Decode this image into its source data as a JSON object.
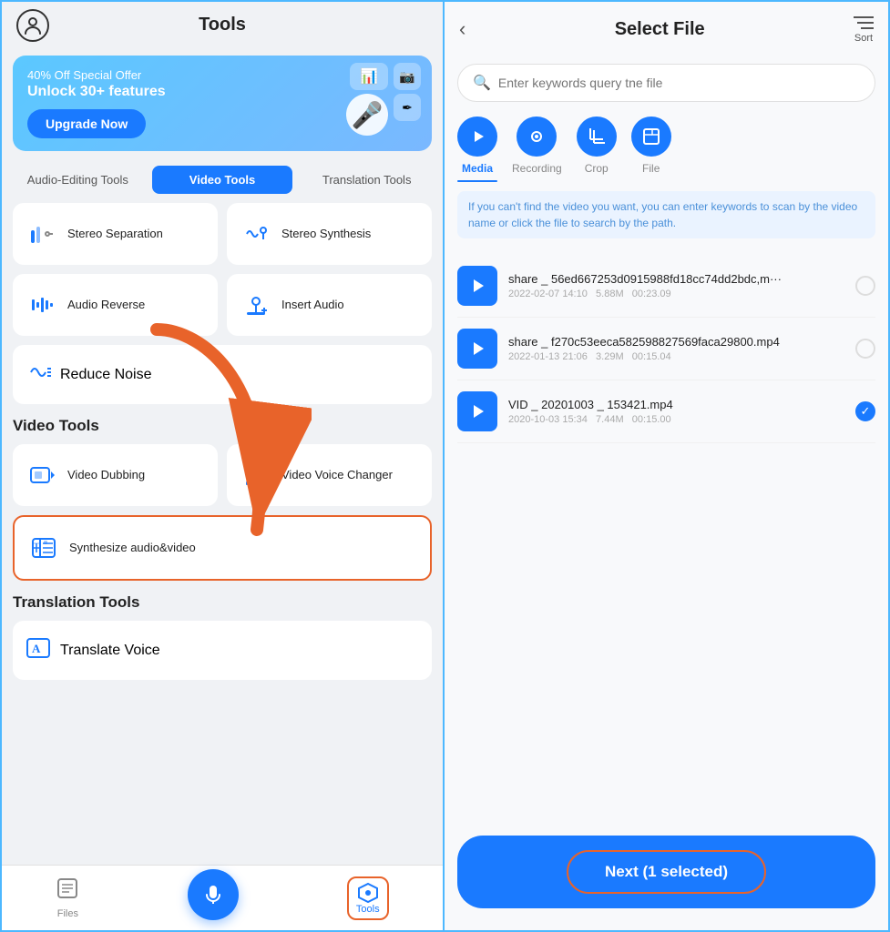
{
  "left": {
    "header": {
      "title": "Tools"
    },
    "promo": {
      "offer": "40% Off Special Offer",
      "unlock": "Unlock 30+ features",
      "btn_label": "Upgrade Now"
    },
    "tabs": [
      {
        "id": "audio",
        "label": "Audio-Editing Tools",
        "active": false
      },
      {
        "id": "video",
        "label": "Video Tools",
        "active": true
      },
      {
        "id": "translation",
        "label": "Translation Tools",
        "active": false
      }
    ],
    "audio_tools_section": {
      "title": "",
      "tools": [
        {
          "id": "stereo-sep",
          "label": "Stereo Separation",
          "icon": "🔇",
          "highlighted": false
        },
        {
          "id": "stereo-synth",
          "label": "Stereo Synthesis",
          "icon": "🔊",
          "highlighted": false
        },
        {
          "id": "audio-reverse",
          "label": "Audio Reverse",
          "icon": "📊",
          "highlighted": false
        },
        {
          "id": "insert-audio",
          "label": "Insert Audio",
          "icon": "🎙",
          "highlighted": false
        },
        {
          "id": "reduce-noise",
          "label": "Reduce Noise",
          "icon": "🔔",
          "highlighted": false
        }
      ]
    },
    "video_tools_section": {
      "title": "Video Tools",
      "tools": [
        {
          "id": "video-dubbing",
          "label": "Video Dubbing",
          "icon": "🎬",
          "highlighted": false
        },
        {
          "id": "video-voice-changer",
          "label": "Video Voice Changer",
          "icon": "🔉",
          "highlighted": false
        },
        {
          "id": "synthesize-av",
          "label": "Synthesize audio&video",
          "icon": "🎞",
          "highlighted": true
        }
      ]
    },
    "translation_tools_section": {
      "title": "Translation Tools",
      "tools": [
        {
          "id": "translate-voice",
          "label": "Translate Voice",
          "icon": "🅐",
          "highlighted": false
        }
      ]
    },
    "bottom_nav": {
      "items": [
        {
          "id": "files",
          "label": "Files",
          "icon": "📋",
          "active": false
        },
        {
          "id": "tools",
          "label": "Tools",
          "icon": "⬡",
          "active": true
        }
      ]
    }
  },
  "right": {
    "header": {
      "title": "Select File",
      "sort_label": "Sort"
    },
    "search": {
      "placeholder": "Enter keywords query tne file"
    },
    "media_tabs": [
      {
        "id": "media",
        "label": "Media",
        "icon": "▶",
        "active": true
      },
      {
        "id": "recording",
        "label": "Recording",
        "icon": "🎥",
        "active": false
      },
      {
        "id": "crop",
        "label": "Crop",
        "icon": "✂",
        "active": false
      },
      {
        "id": "file",
        "label": "File",
        "icon": "📁",
        "active": false
      }
    ],
    "hint": "If you can't find the video you want, you can enter keywords to scan by the video name or click the file to search by the path.",
    "files": [
      {
        "id": "file1",
        "name": "share _ 56ed667253d0915988fd18cc74dd2bdc,m···",
        "date": "2022-02-07 14:10",
        "size": "5.88M",
        "duration": "00:23.09",
        "selected": false
      },
      {
        "id": "file2",
        "name": "share _ f270c53eeca582598827569faca29800.mp4",
        "date": "2022-01-13 21:06",
        "size": "3.29M",
        "duration": "00:15.04",
        "selected": false
      },
      {
        "id": "file3",
        "name": "VID _ 20201003 _ 153421.mp4",
        "date": "2020-10-03 15:34",
        "size": "7.44M",
        "duration": "00:15.00",
        "selected": true
      }
    ],
    "footer": {
      "next_btn": "Next (1 selected)"
    }
  }
}
